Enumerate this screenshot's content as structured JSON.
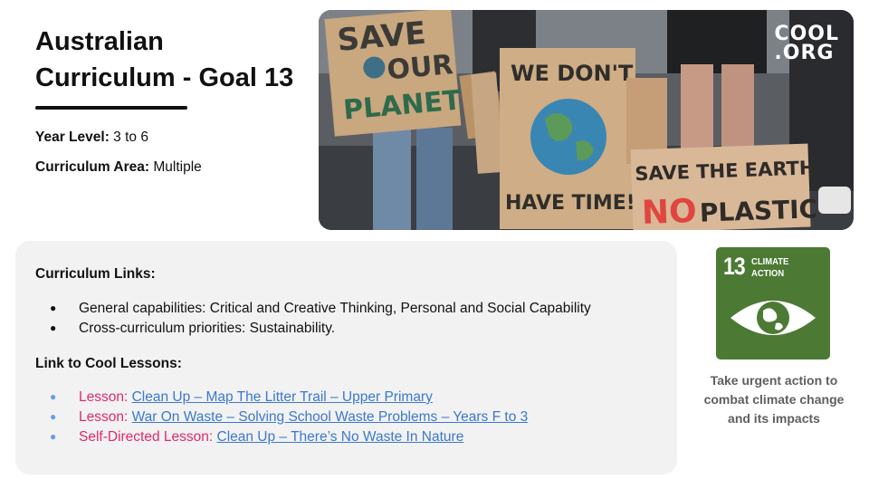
{
  "header": {
    "title": "Australian Curriculum - Goal 13",
    "year_level_label": "Year Level:",
    "year_level_value": "3 to 6",
    "curriculum_area_label": "Curriculum Area:",
    "curriculum_area_value": "Multiple"
  },
  "photo": {
    "brand_line1": "COOL",
    "brand_line2": ".ORG",
    "sign_texts": [
      "SAVE",
      "OUR",
      "PLANET",
      "WE DON'T",
      "HAVE TIME!",
      "SAVE THE EARTH",
      "NO",
      "PLASTIC"
    ]
  },
  "panel": {
    "curriculum_links_heading": "Curriculum Links:",
    "curriculum_links": [
      "General capabilities: Critical and Creative Thinking, Personal and Social Capability",
      "Cross-curriculum priorities: Sustainability."
    ],
    "cool_lessons_heading": "Link to Cool Lessons:",
    "cool_lessons": [
      {
        "label": "Lesson: ",
        "link": "Clean Up – Map The Litter Trail – Upper Primary"
      },
      {
        "label": "Lesson: ",
        "link": "War On Waste – Solving School Waste Problems – Years F to 3"
      },
      {
        "label": "Self-Directed Lesson: ",
        "link": "Clean Up – There’s No Waste In Nature"
      }
    ]
  },
  "sdg": {
    "number": "13",
    "line1": "CLIMATE",
    "line2": "ACTION",
    "caption": "Take urgent action to combat climate change and its impacts"
  },
  "colors": {
    "sdg_green": "#4c7a34",
    "lesson_label": "#e0286e",
    "link": "#3b78cf",
    "panel_bg": "#f2f2f2"
  }
}
